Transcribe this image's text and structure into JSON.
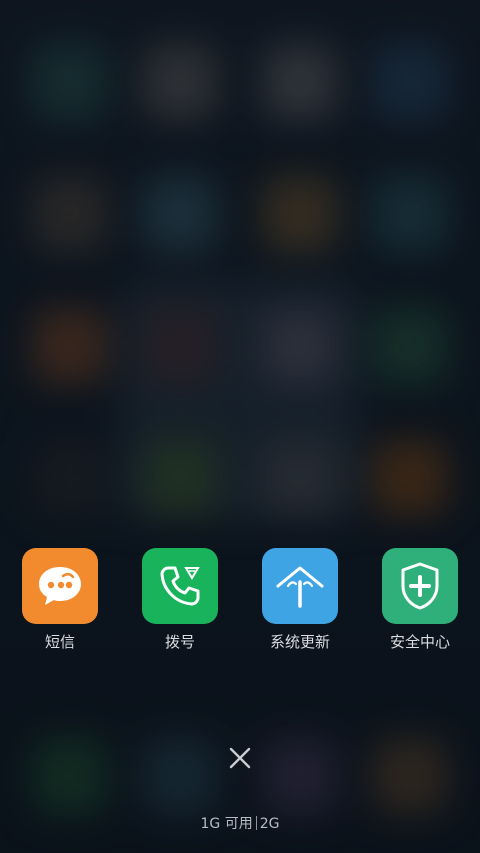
{
  "colors": {
    "sms_icon_bg": "#f28a2e",
    "dialer_icon_bg": "#19b35b",
    "updater_icon_bg": "#3ea4e4",
    "security_icon_bg": "#2fb07a"
  },
  "recent_apps": [
    {
      "label": "短信",
      "icon": "message-bubble-icon"
    },
    {
      "label": "拨号",
      "icon": "phone-handset-icon"
    },
    {
      "label": "系统更新",
      "icon": "update-arrow-icon"
    },
    {
      "label": "安全中心",
      "icon": "shield-plus-icon"
    }
  ],
  "close_button": {
    "icon": "close-icon"
  },
  "memory": {
    "available": "1G 可用",
    "total": "2G"
  }
}
